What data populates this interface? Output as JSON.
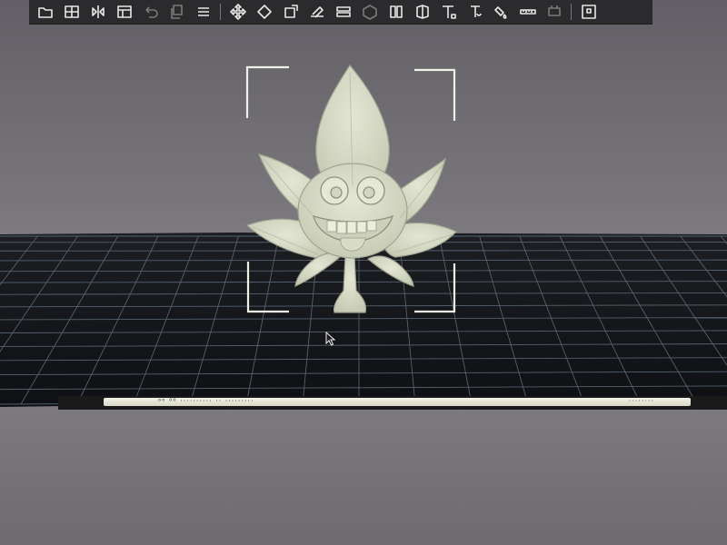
{
  "toolbar": {
    "buttons": [
      {
        "icon": "open-file-icon"
      },
      {
        "icon": "grid-layout-icon"
      },
      {
        "icon": "mirror-icon"
      },
      {
        "icon": "layout-icon"
      },
      {
        "icon": "undo-icon",
        "dim": true
      },
      {
        "icon": "copy-icon",
        "dim": true
      },
      {
        "icon": "list-icon"
      },
      {
        "icon": "move-icon"
      },
      {
        "icon": "rotate-icon"
      },
      {
        "icon": "scale-icon"
      },
      {
        "icon": "lay-flat-icon"
      },
      {
        "icon": "layers-icon"
      },
      {
        "icon": "cube-icon",
        "dim": true
      },
      {
        "icon": "split-icon"
      },
      {
        "icon": "hollow-icon"
      },
      {
        "icon": "cut-icon"
      },
      {
        "icon": "text-icon"
      },
      {
        "icon": "paint-icon"
      },
      {
        "icon": "measure-icon"
      },
      {
        "icon": "support-icon",
        "dim": true
      },
      {
        "icon": "puzzle-icon"
      }
    ]
  },
  "status": {
    "left_text": "ᵒᵒ ⁰⁰ ·········· ·· ·········",
    "right_text": "········"
  },
  "colors": {
    "model": "#d6d9c4",
    "grid_line": "#6d7a86",
    "plate": "#15161a",
    "selection_bracket": "#eef2e6"
  }
}
